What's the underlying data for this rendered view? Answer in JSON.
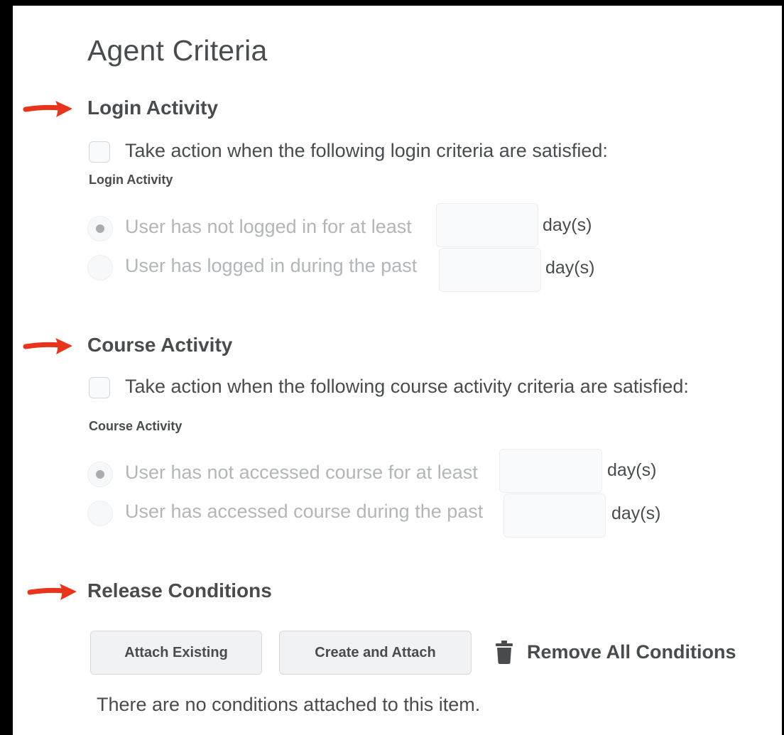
{
  "page": {
    "title": "Agent Criteria"
  },
  "login": {
    "heading": "Login Activity",
    "checkbox_label": "Take action when the following login criteria are satisfied:",
    "sublabel": "Login Activity",
    "option1_label": "User has not logged in for at least",
    "option1_value": "",
    "option1_unit": "day(s)",
    "option2_label": "User has logged in during the past",
    "option2_value": "",
    "option2_unit": "day(s)"
  },
  "course": {
    "heading": "Course Activity",
    "checkbox_label": "Take action when the following course activity criteria are satisfied:",
    "sublabel": "Course Activity",
    "option1_label": "User has not accessed course for at least",
    "option1_value": "",
    "option1_unit": "day(s)",
    "option2_label": "User has accessed course during the past",
    "option2_value": "",
    "option2_unit": "day(s)"
  },
  "release": {
    "heading": "Release Conditions",
    "attach_existing_label": "Attach Existing",
    "create_attach_label": "Create and Attach",
    "remove_all_label": "Remove All Conditions",
    "empty_message": "There are no conditions attached to this item."
  },
  "icons": {
    "annotation_arrow": "red-arrow-icon",
    "trash": "trash-icon"
  },
  "colors": {
    "arrow": "#e8341c",
    "text": "#494c4e",
    "disabled_text": "#b3b6b9",
    "button_bg": "#f1f2f4",
    "border": "#d3d9e3"
  }
}
